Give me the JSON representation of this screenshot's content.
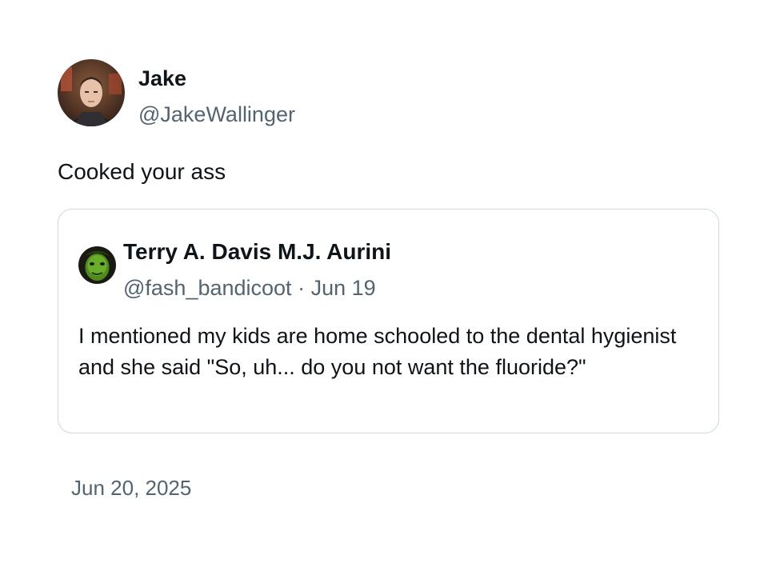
{
  "tweet": {
    "author": {
      "display_name": "Jake",
      "handle": "@JakeWallinger",
      "avatar_icon": "user-photo-avatar"
    },
    "text": "Cooked your ass",
    "timestamp": "Jun 20, 2025"
  },
  "quoted_tweet": {
    "author": {
      "display_name": "Terry A. Davis M.J. Aurini",
      "handle": "@fash_bandicoot",
      "avatar_icon": "green-face-avatar"
    },
    "separator": "·",
    "date": "Jun 19",
    "text": "I mentioned my kids are home schooled to the dental hygienist and she said \"So, uh... do you not want the fluoride?\""
  },
  "colors": {
    "primary_text": "#0f1419",
    "secondary_text": "#536471",
    "border": "#cfd9de"
  }
}
